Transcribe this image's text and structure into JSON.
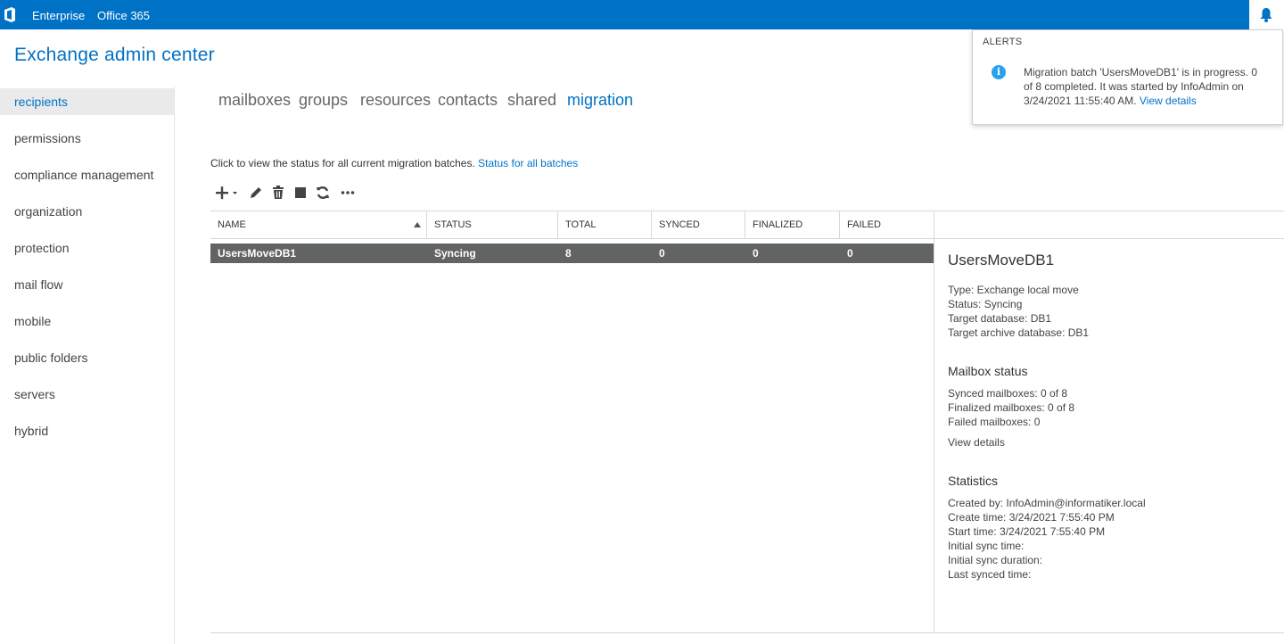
{
  "topbar": {
    "enterprise": "Enterprise",
    "office365": "Office 365",
    "bg_color": "#0072c6"
  },
  "app": {
    "title": "Exchange admin center"
  },
  "leftnav": {
    "items": [
      {
        "label": "recipients",
        "active": true
      },
      {
        "label": "permissions"
      },
      {
        "label": "compliance management"
      },
      {
        "label": "organization"
      },
      {
        "label": "protection"
      },
      {
        "label": "mail flow"
      },
      {
        "label": "mobile"
      },
      {
        "label": "public folders"
      },
      {
        "label": "servers"
      },
      {
        "label": "hybrid"
      }
    ]
  },
  "tabs": [
    {
      "label": "mailboxes"
    },
    {
      "label": "groups"
    },
    {
      "label": "resources"
    },
    {
      "label": "contacts"
    },
    {
      "label": "shared"
    },
    {
      "label": "migration",
      "active": true
    }
  ],
  "info": {
    "text": "Click to view the status for all current migration batches.",
    "link": "Status for all batches"
  },
  "toolbar": {
    "icons": [
      "add-icon",
      "edit-icon",
      "delete-icon",
      "stop-icon",
      "refresh-icon",
      "more-icon"
    ]
  },
  "grid": {
    "columns": [
      "NAME",
      "STATUS",
      "TOTAL",
      "SYNCED",
      "FINALIZED",
      "FAILED"
    ],
    "rows": [
      {
        "name": "UsersMoveDB1",
        "status": "Syncing",
        "total": "8",
        "synced": "0",
        "finalized": "0",
        "failed": "0"
      }
    ]
  },
  "details": {
    "title": "UsersMoveDB1",
    "type": "Type: Exchange local move",
    "status": "Status: Syncing",
    "target_db": "Target database: DB1",
    "target_archive_db": "Target archive database: DB1",
    "mailbox_status_heading": "Mailbox status",
    "synced_mailboxes": "Synced mailboxes: 0 of 8",
    "finalized_mailboxes": "Finalized mailboxes: 0 of 8",
    "failed_mailboxes": "Failed mailboxes: 0",
    "view_details": "View details",
    "statistics_heading": "Statistics",
    "created_by": "Created by: InfoAdmin@informatiker.local",
    "create_time": "Create time: 3/24/2021 7:55:40 PM",
    "start_time": "Start time: 3/24/2021 7:55:40 PM",
    "initial_sync_time": "Initial sync time:",
    "initial_sync_duration": "Initial sync duration:",
    "last_synced_time": "Last synced time:"
  },
  "alerts": {
    "heading": "ALERTS",
    "message": "Migration batch 'UsersMoveDB1' is in progress. 0 of 8 completed. It was started by InfoAdmin on 3/24/2021 11:55:40 AM.",
    "link": "View details"
  }
}
